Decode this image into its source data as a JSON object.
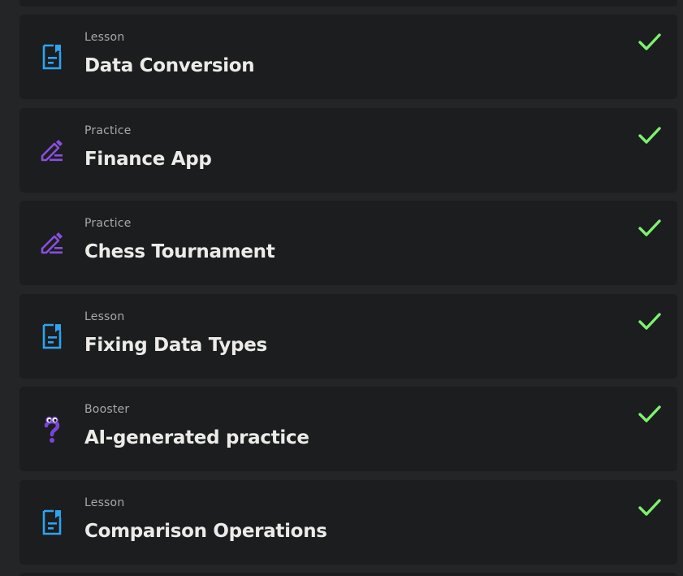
{
  "colors": {
    "background": "#232527",
    "card": "#1b1d1f",
    "lesson_icon": "#2ea3ee",
    "practice_icon": "#8a4fde",
    "booster_icon": "#7a45d6",
    "check": "#7ef26c",
    "kind_text": "#a8a9ab",
    "title_text": "#ecebe8"
  },
  "items": [
    {
      "kind": "Lesson",
      "title": "Data Conversion",
      "icon": "lesson-icon",
      "completed": true
    },
    {
      "kind": "Practice",
      "title": "Finance App",
      "icon": "pencil-icon",
      "completed": true
    },
    {
      "kind": "Practice",
      "title": "Chess Tournament",
      "icon": "pencil-icon",
      "completed": true
    },
    {
      "kind": "Lesson",
      "title": "Fixing Data Types",
      "icon": "lesson-icon",
      "completed": true
    },
    {
      "kind": "Booster",
      "title": "AI-generated practice",
      "icon": "question-mark-icon",
      "completed": true
    },
    {
      "kind": "Lesson",
      "title": "Comparison Operations",
      "icon": "lesson-icon",
      "completed": true
    }
  ]
}
